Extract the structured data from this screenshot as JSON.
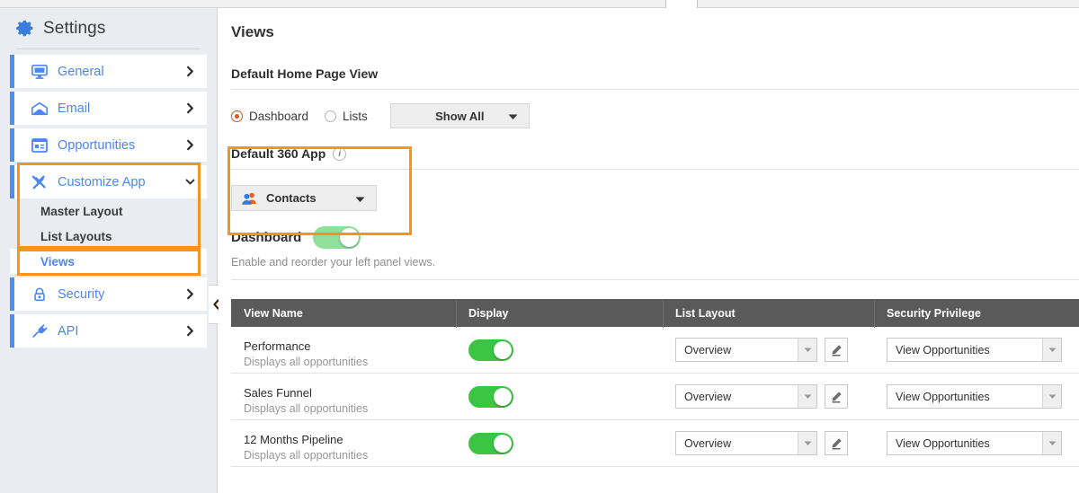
{
  "sidebar": {
    "title": "Settings",
    "title_icon": "gear-icon",
    "items": [
      {
        "label": "General",
        "icon": "monitor-icon",
        "chevron": "chevron-right-icon"
      },
      {
        "label": "Email",
        "icon": "envelope-icon",
        "chevron": "chevron-right-icon"
      },
      {
        "label": "Opportunities",
        "icon": "window-list-icon",
        "chevron": "chevron-right-icon"
      },
      {
        "label": "Customize App",
        "icon": "tools-icon",
        "chevron": "chevron-down-icon"
      },
      {
        "label": "Security",
        "icon": "lock-icon",
        "chevron": "chevron-right-icon"
      },
      {
        "label": "API",
        "icon": "plug-icon",
        "chevron": "chevron-right-icon"
      }
    ],
    "submenu": [
      {
        "label": "Master Layout",
        "selected": false
      },
      {
        "label": "List Layouts",
        "selected": false
      },
      {
        "label": "Views",
        "selected": true
      }
    ],
    "collapse_icon": "chevron-left-icon"
  },
  "main": {
    "page_title": "Views",
    "section_title": "Default Home Page View",
    "radios": [
      {
        "label": "Dashboard",
        "selected": true
      },
      {
        "label": "Lists",
        "selected": false
      }
    ],
    "show_all_button": "Show All",
    "app360": {
      "title": "Default 360 App",
      "info_icon": "info-icon",
      "info_glyph": "i",
      "selected_app": "Contacts",
      "app_icon": "contacts-people-icon"
    },
    "dashboard": {
      "label": "Dashboard",
      "enabled": true,
      "helper_text": "Enable and reorder your left panel views."
    },
    "table": {
      "columns": [
        "View Name",
        "Display",
        "List Layout",
        "Security Privilege"
      ],
      "rows": [
        {
          "name": "Performance",
          "description": "Displays all opportunities",
          "display_enabled": true,
          "list_layout": "Overview",
          "security_privilege": "View Opportunities",
          "edit_icon": "pencil-icon"
        },
        {
          "name": "Sales Funnel",
          "description": "Displays all opportunities",
          "display_enabled": true,
          "list_layout": "Overview",
          "security_privilege": "View Opportunities",
          "edit_icon": "pencil-icon"
        },
        {
          "name": "12 Months Pipeline",
          "description": "Displays all opportunities",
          "display_enabled": true,
          "list_layout": "Overview",
          "security_privilege": "View Opportunities",
          "edit_icon": "pencil-icon"
        }
      ]
    }
  },
  "colors": {
    "accent_blue": "#4a86f7",
    "highlight_orange": "#f79420",
    "toggle_green": "#3ac642",
    "toggle_green_light": "#8fe09a",
    "radio_orange": "#e05a1b",
    "table_header": "#5a5a5a",
    "sidebar_bg": "#e9ecf1"
  }
}
